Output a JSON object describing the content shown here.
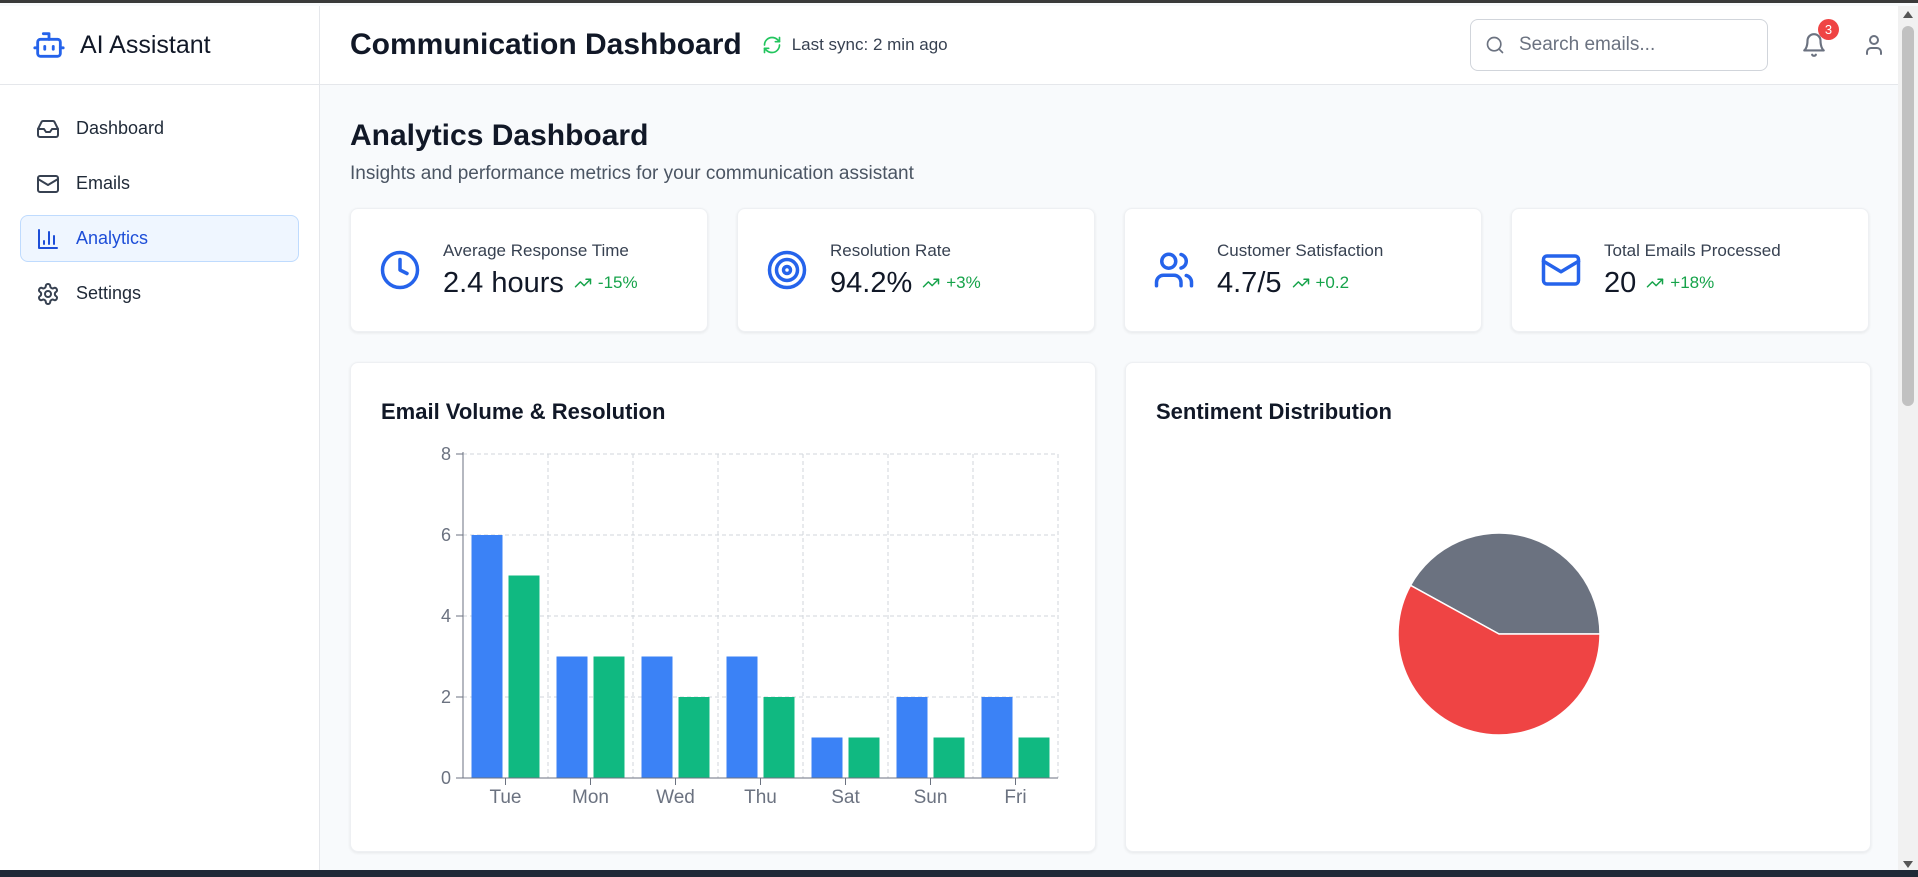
{
  "app": {
    "title": "AI Assistant"
  },
  "sidebar": {
    "items": [
      {
        "label": "Dashboard",
        "icon": "inbox-icon"
      },
      {
        "label": "Emails",
        "icon": "mail-icon"
      },
      {
        "label": "Analytics",
        "icon": "bar-chart-icon",
        "active": true
      },
      {
        "label": "Settings",
        "icon": "gear-icon"
      }
    ]
  },
  "header": {
    "title": "Communication Dashboard",
    "sync_text": "Last sync: 2 min ago",
    "search_placeholder": "Search emails...",
    "notification_count": "3"
  },
  "page": {
    "title": "Analytics Dashboard",
    "subtitle": "Insights and performance metrics for your communication assistant"
  },
  "cards": [
    {
      "label": "Average Response Time",
      "value": "2.4 hours",
      "change": "-15%",
      "icon": "clock-icon"
    },
    {
      "label": "Resolution Rate",
      "value": "94.2%",
      "change": "+3%",
      "icon": "target-icon"
    },
    {
      "label": "Customer Satisfaction",
      "value": "4.7/5",
      "change": "+0.2",
      "icon": "users-icon"
    },
    {
      "label": "Total Emails Processed",
      "value": "20",
      "change": "+18%",
      "icon": "mail-icon"
    }
  ],
  "colors": {
    "accent": "#2563eb",
    "bar_blue": "#3b82f6",
    "bar_green": "#10b981",
    "positive": "#16a34a",
    "pie_gray": "#6b7280",
    "pie_red": "#ef4444"
  },
  "chart_data": [
    {
      "type": "bar",
      "title": "Email Volume & Resolution",
      "categories": [
        "Tue",
        "Mon",
        "Wed",
        "Thu",
        "Sat",
        "Sun",
        "Fri"
      ],
      "series": [
        {
          "values": [
            6,
            3,
            3,
            3,
            1,
            2,
            2
          ],
          "color": "#3b82f6"
        },
        {
          "values": [
            5,
            3,
            2,
            2,
            1,
            1,
            1
          ],
          "color": "#10b981"
        }
      ],
      "ylim": [
        0,
        8
      ],
      "yticks": [
        0,
        2,
        4,
        6,
        8
      ],
      "grid": true
    },
    {
      "type": "pie",
      "title": "Sentiment Distribution",
      "slices": [
        {
          "value": 42,
          "color": "#6b7280"
        },
        {
          "value": 58,
          "color": "#ef4444"
        }
      ]
    }
  ]
}
